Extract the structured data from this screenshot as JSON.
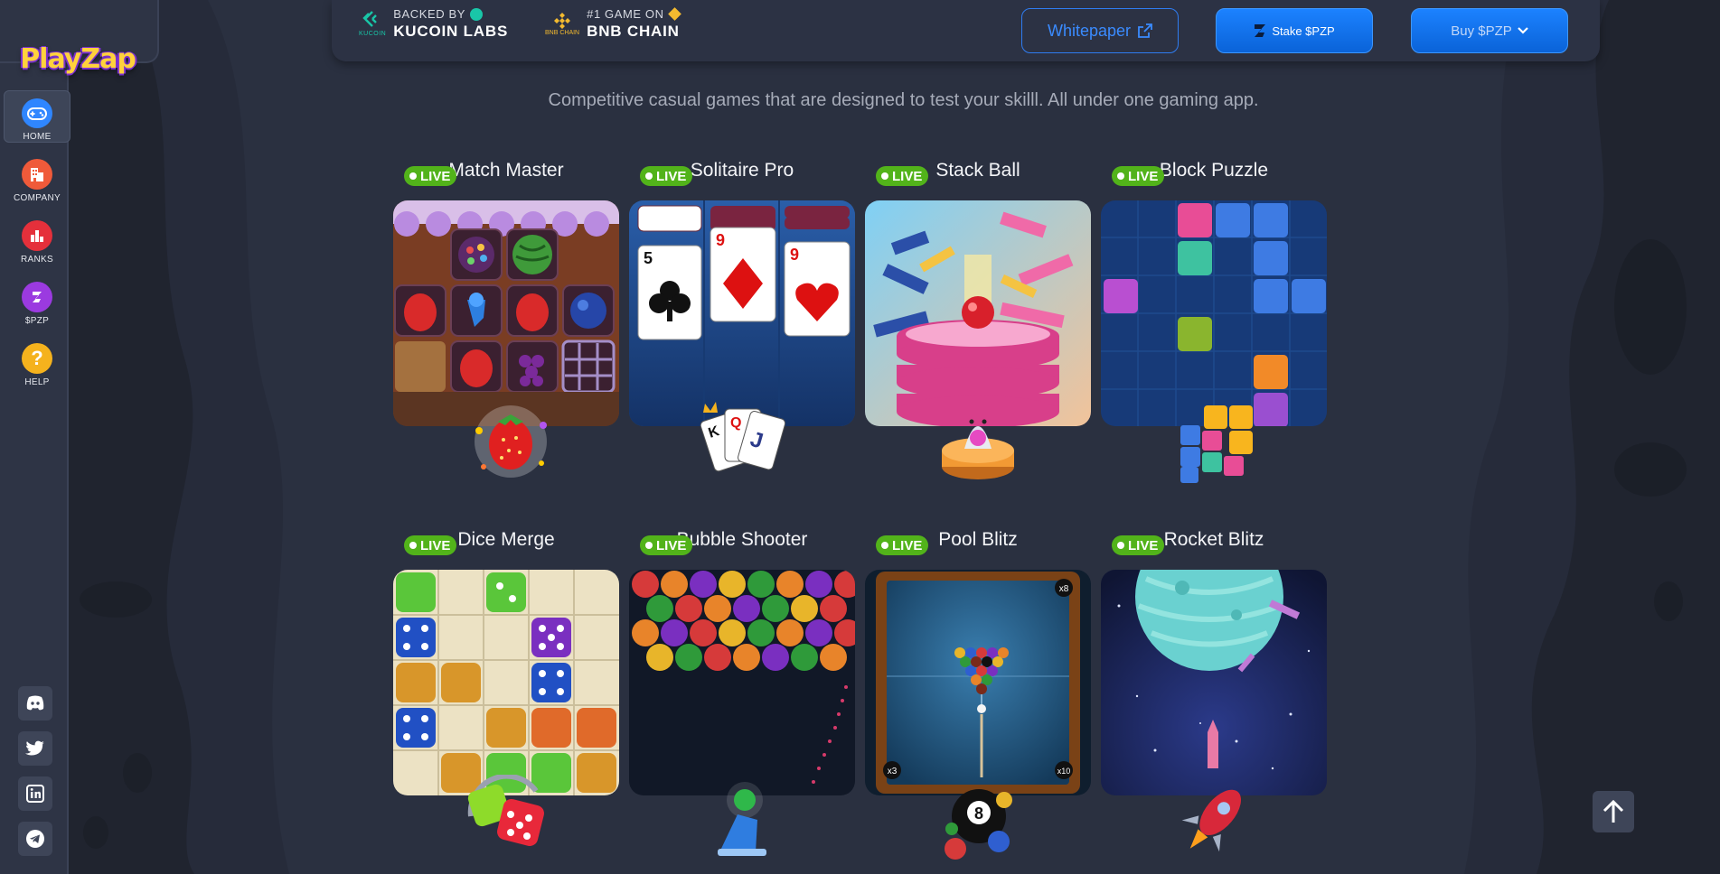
{
  "brand": {
    "logo_text": "PlayZap"
  },
  "sidebar": {
    "items": [
      {
        "label": "HOME",
        "icon": "gamepad-icon",
        "active": true
      },
      {
        "label": "COMPANY",
        "icon": "building-icon",
        "active": false
      },
      {
        "label": "RANKS",
        "icon": "bar-chart-icon",
        "active": false
      },
      {
        "label": "$PZP",
        "icon": "pzp-token-icon",
        "active": false
      },
      {
        "label": "HELP",
        "icon": "question-icon",
        "active": false
      }
    ],
    "socials": [
      "discord-icon",
      "twitter-icon",
      "linkedin-icon",
      "telegram-icon"
    ]
  },
  "topbar": {
    "backer1_small": "BACKED BY",
    "backer1_big": "KUCOIN LABS",
    "backer1_logo_caption": "KUCOIN",
    "backer2_small": "#1 GAME ON",
    "backer2_big": "BNB CHAIN",
    "backer2_logo_caption": "BNB CHAIN",
    "whitepaper_label": "Whitepaper",
    "stake_label": "Stake $PZP",
    "buy_label": "Buy $PZP"
  },
  "tagline": "Competitive casual games that are designed to test your skilll. All under one gaming app.",
  "games": [
    {
      "title": "Match Master",
      "badge": "LIVE"
    },
    {
      "title": "Solitaire Pro",
      "badge": "LIVE"
    },
    {
      "title": "Stack Ball",
      "badge": "LIVE"
    },
    {
      "title": "Block Puzzle",
      "badge": "LIVE"
    },
    {
      "title": "Dice Merge",
      "badge": "LIVE"
    },
    {
      "title": "Bubble Shooter",
      "badge": "LIVE"
    },
    {
      "title": "Pool Blitz",
      "badge": "LIVE"
    },
    {
      "title": "Rocket Blitz",
      "badge": "LIVE"
    }
  ],
  "cards": {
    "solitaire": [
      "5",
      "9",
      "9",
      "K",
      "Q",
      "J"
    ],
    "pool": {
      "corner_tr": "x8",
      "corner_bl": "x3",
      "corner_br": "x10",
      "ball": "8"
    }
  },
  "colors": {
    "accent": "#1c82ff",
    "live": "#52b31a",
    "background": "#232838",
    "sidebar": "#2e3445"
  }
}
